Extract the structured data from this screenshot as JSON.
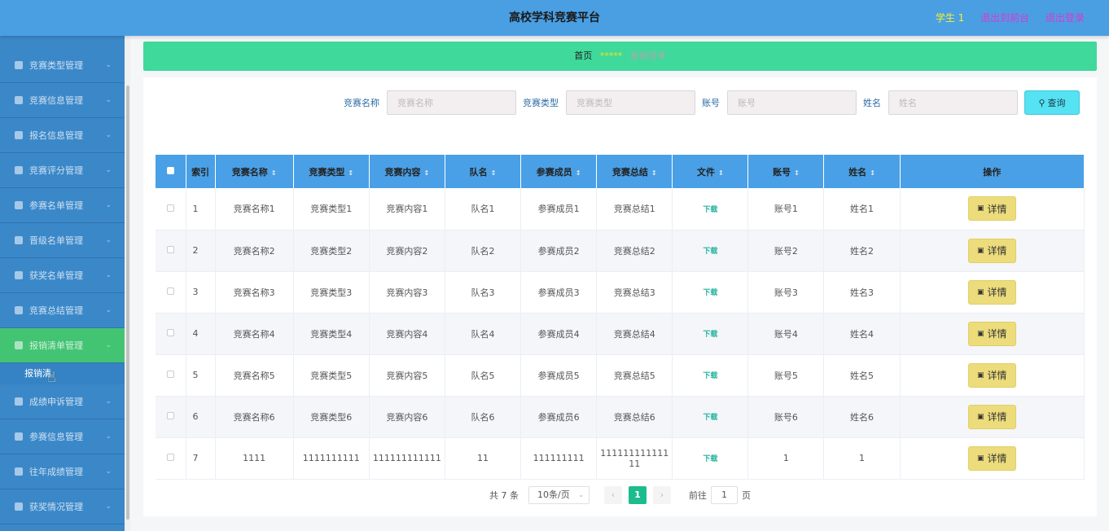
{
  "header": {
    "title": "高校学科竞赛平台",
    "user_name": "学生 1",
    "to_front": "退出到前台",
    "logout": "退出登录"
  },
  "sidebar": {
    "items": [
      {
        "label": "竞赛类型管理",
        "icon": "list-icon"
      },
      {
        "label": "竞赛信息管理",
        "icon": "document-icon"
      },
      {
        "label": "报名信息管理",
        "icon": "sliders-icon"
      },
      {
        "label": "竞赛评分管理",
        "icon": "clock-icon"
      },
      {
        "label": "参赛名单管理",
        "icon": "briefcase-icon"
      },
      {
        "label": "晋级名单管理",
        "icon": "bar-chart-icon"
      },
      {
        "label": "获奖名单管理",
        "icon": "printer-icon"
      },
      {
        "label": "竞赛总结管理",
        "icon": "power-icon"
      },
      {
        "label": "报销清单管理",
        "icon": "grid-icon",
        "active": true
      },
      {
        "label": "成绩申诉管理",
        "icon": "location-icon"
      },
      {
        "label": "参赛信息管理",
        "icon": "mail-icon"
      },
      {
        "label": "往年成绩管理",
        "icon": "crop-icon"
      },
      {
        "label": "获奖情况管理",
        "icon": "flag-icon"
      }
    ],
    "submenu_label": "报销清"
  },
  "breadcrumb": {
    "home": "首页",
    "separator": "*****",
    "current": "报销清单"
  },
  "search": {
    "name_label": "竞赛名称",
    "name_placeholder": "竞赛名称",
    "type_label": "竞赛类型",
    "type_placeholder": "竞赛类型",
    "account_label": "账号",
    "account_placeholder": "账号",
    "realname_label": "姓名",
    "realname_placeholder": "姓名",
    "query_label": "查询"
  },
  "table": {
    "columns": [
      "索引",
      "竞赛名称",
      "竞赛类型",
      "竞赛内容",
      "队名",
      "参赛成员",
      "竞赛总结",
      "文件",
      "账号",
      "姓名",
      "操作"
    ],
    "download_label": "下载",
    "detail_label": "详情",
    "rows": [
      {
        "index": "1",
        "name": "竞赛名称1",
        "type": "竞赛类型1",
        "content": "竞赛内容1",
        "team": "队名1",
        "members": "参赛成员1",
        "summary": "竞赛总结1",
        "account": "账号1",
        "realname": "姓名1"
      },
      {
        "index": "2",
        "name": "竞赛名称2",
        "type": "竞赛类型2",
        "content": "竞赛内容2",
        "team": "队名2",
        "members": "参赛成员2",
        "summary": "竞赛总结2",
        "account": "账号2",
        "realname": "姓名2"
      },
      {
        "index": "3",
        "name": "竞赛名称3",
        "type": "竞赛类型3",
        "content": "竞赛内容3",
        "team": "队名3",
        "members": "参赛成员3",
        "summary": "竞赛总结3",
        "account": "账号3",
        "realname": "姓名3"
      },
      {
        "index": "4",
        "name": "竞赛名称4",
        "type": "竞赛类型4",
        "content": "竞赛内容4",
        "team": "队名4",
        "members": "参赛成员4",
        "summary": "竞赛总结4",
        "account": "账号4",
        "realname": "姓名4"
      },
      {
        "index": "5",
        "name": "竞赛名称5",
        "type": "竞赛类型5",
        "content": "竞赛内容5",
        "team": "队名5",
        "members": "参赛成员5",
        "summary": "竞赛总结5",
        "account": "账号5",
        "realname": "姓名5"
      },
      {
        "index": "6",
        "name": "竞赛名称6",
        "type": "竞赛类型6",
        "content": "竞赛内容6",
        "team": "队名6",
        "members": "参赛成员6",
        "summary": "竞赛总结6",
        "account": "账号6",
        "realname": "姓名6"
      },
      {
        "index": "7",
        "name": "1111",
        "type": "1111111111",
        "content": "111111111111",
        "team": "11",
        "members": "111111111",
        "summary": "111111111111 11",
        "account": "1",
        "realname": "1"
      }
    ]
  },
  "pagination": {
    "total": "共 7 条",
    "page_size": "10条/页",
    "current_page": "1",
    "goto_label": "前往",
    "goto_value": "1",
    "page_suffix": "页"
  },
  "colors": {
    "header_bg": "#4a9fe3",
    "sidebar_bg": "#3b88c9",
    "active_menu": "#43c473",
    "breadcrumb_bg": "#3fd99b",
    "table_header": "#49a0e6",
    "detail_button": "#ecdc7c",
    "query_button": "#55e2f2",
    "page_active": "#1cbc8f"
  }
}
